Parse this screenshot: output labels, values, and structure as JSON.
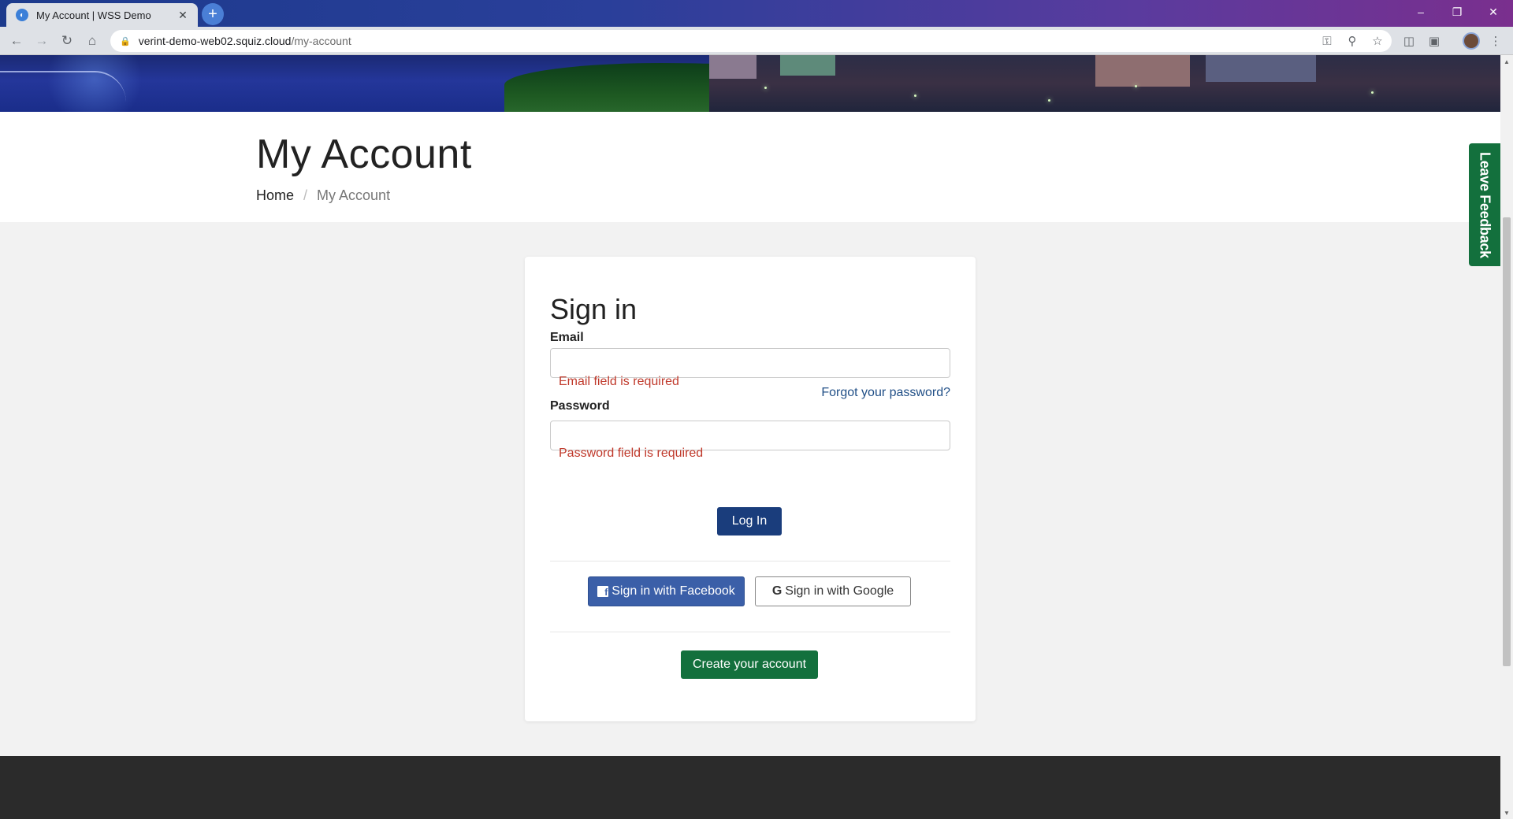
{
  "browser": {
    "tab_title": "My Account | WSS Demo",
    "tab_close": "✕",
    "new_tab": "+",
    "url_host": "verint-demo-web02.squiz.cloud",
    "url_path": "/my-account",
    "window_controls": {
      "minimize": "–",
      "restore": "❐",
      "close": "✕"
    }
  },
  "page": {
    "title": "My Account",
    "breadcrumb": {
      "home": "Home",
      "separator": "/",
      "current": "My Account"
    },
    "feedback_tab": "Leave Feedback"
  },
  "signin": {
    "heading": "Sign in",
    "email_label": "Email",
    "email_value": "",
    "email_error": "Email field is required",
    "password_label": "Password",
    "password_value": "",
    "forgot_link": "Forgot your password?",
    "password_error": "Password field is required",
    "login_button": "Log In",
    "facebook_button": "Sign in with Facebook",
    "google_button": "Sign in with Google",
    "create_button": "Create your account"
  },
  "colors": {
    "primary_button": "#1a3d7c",
    "facebook": "#3b5fa8",
    "create_account": "#13703d",
    "error": "#c0392b",
    "link": "#1f4e86",
    "footer": "#2b2b2b"
  },
  "icons": [
    "back-arrow-icon",
    "forward-arrow-icon",
    "reload-icon",
    "home-icon",
    "lock-icon",
    "key-icon",
    "zoom-icon",
    "star-icon",
    "extension-icon",
    "menu-dots-icon",
    "facebook-icon",
    "google-icon"
  ]
}
